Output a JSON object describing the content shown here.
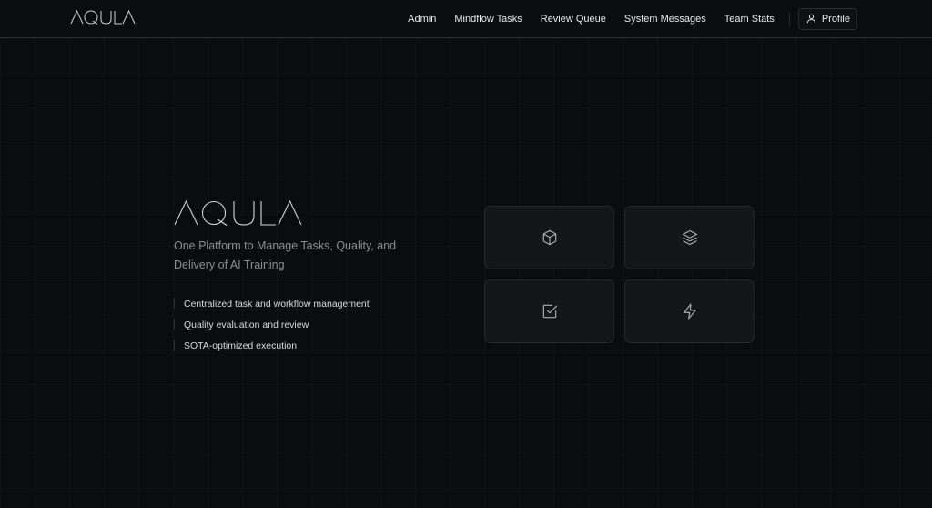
{
  "header": {
    "logo_text": "AQULA",
    "nav": [
      {
        "label": "Admin"
      },
      {
        "label": "Mindflow Tasks"
      },
      {
        "label": "Review Queue"
      },
      {
        "label": "System Messages"
      },
      {
        "label": "Team Stats"
      }
    ],
    "profile": {
      "label": "Profile",
      "icon": "user-icon"
    }
  },
  "hero": {
    "logo_text": "AQULA",
    "tagline": "One Platform to Manage Tasks, Quality, and Delivery of AI Training",
    "features": [
      "Centralized task and workflow management",
      "Quality evaluation and review",
      "SOTA-optimized execution"
    ]
  },
  "cards": [
    {
      "icon": "cube-icon"
    },
    {
      "icon": "layers-icon"
    },
    {
      "icon": "checkbox-icon"
    },
    {
      "icon": "lightning-icon"
    }
  ],
  "colors": {
    "background": "#0b0c0d",
    "header_border": "#1f3a2c",
    "card_bg": "#141719",
    "card_border": "#262a2e",
    "muted_text": "#8a8f95"
  }
}
